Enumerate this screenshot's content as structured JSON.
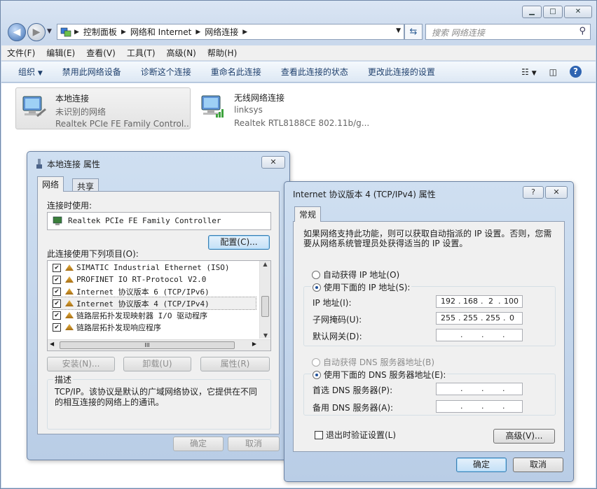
{
  "window": {
    "caption": {
      "minimize": "▁",
      "maximize": "□",
      "close": "✕"
    }
  },
  "address": {
    "segments": [
      "控制面板",
      "网络和 Internet",
      "网络连接"
    ],
    "search_placeholder": "搜索 网络连接"
  },
  "menu": [
    "文件(F)",
    "编辑(E)",
    "查看(V)",
    "工具(T)",
    "高级(N)",
    "帮助(H)"
  ],
  "commands": [
    "组织",
    "禁用此网络设备",
    "诊断这个连接",
    "重命名此连接",
    "查看此连接的状态",
    "更改此连接的设置"
  ],
  "connections": [
    {
      "name": "本地连接",
      "status": "未识别的网络",
      "device": "Realtek PCIe FE Family Control..."
    },
    {
      "name": "无线网络连接",
      "status": "linksys",
      "device": "Realtek RTL8188CE 802.11b/g..."
    }
  ],
  "props": {
    "title": "本地连接 属性",
    "tabs": [
      "网络",
      "共享"
    ],
    "connect_using_label": "连接时使用:",
    "adapter": "Realtek PCIe FE Family Controller",
    "configure": "配置(C)...",
    "items_label": "此连接使用下列项目(O):",
    "items": [
      "SIMATIC Industrial Ethernet (ISO)",
      "PROFINET IO RT-Protocol V2.0",
      "Internet 协议版本 6 (TCP/IPv6)",
      "Internet 协议版本 4 (TCP/IPv4)",
      "链路层拓扑发现映射器 I/O 驱动程序",
      "链路层拓扑发现响应程序"
    ],
    "hscroll_grip": "III",
    "install": "安装(N)...",
    "uninstall": "卸载(U)",
    "properties": "属性(R)",
    "description_label": "描述",
    "description": "TCP/IP。该协议是默认的广域网络协议，它提供在不同的相互连接的网络上的通讯。",
    "ok": "确定",
    "cancel": "取消"
  },
  "ipv4": {
    "title": "Internet 协议版本 4 (TCP/IPv4) 属性",
    "help": "?",
    "tab": "常规",
    "intro": "如果网络支持此功能，则可以获取自动指派的 IP 设置。否则，您需要从网络系统管理员处获得适当的 IP 设置。",
    "auto_ip": "自动获得 IP 地址(O)",
    "use_ip": "使用下面的 IP 地址(S):",
    "ip_label": "IP 地址(I):",
    "mask_label": "子网掩码(U):",
    "gateway_label": "默认网关(D):",
    "ip_value": [
      "192",
      "168",
      "2",
      "100"
    ],
    "mask_value": [
      "255",
      "255",
      "255",
      "0"
    ],
    "auto_dns": "自动获得 DNS 服务器地址(B)",
    "use_dns": "使用下面的 DNS 服务器地址(E):",
    "dns1_label": "首选 DNS 服务器(P):",
    "dns2_label": "备用 DNS 服务器(A):",
    "validate": "退出时验证设置(L)",
    "advanced": "高级(V)...",
    "ok": "确定",
    "cancel": "取消"
  }
}
